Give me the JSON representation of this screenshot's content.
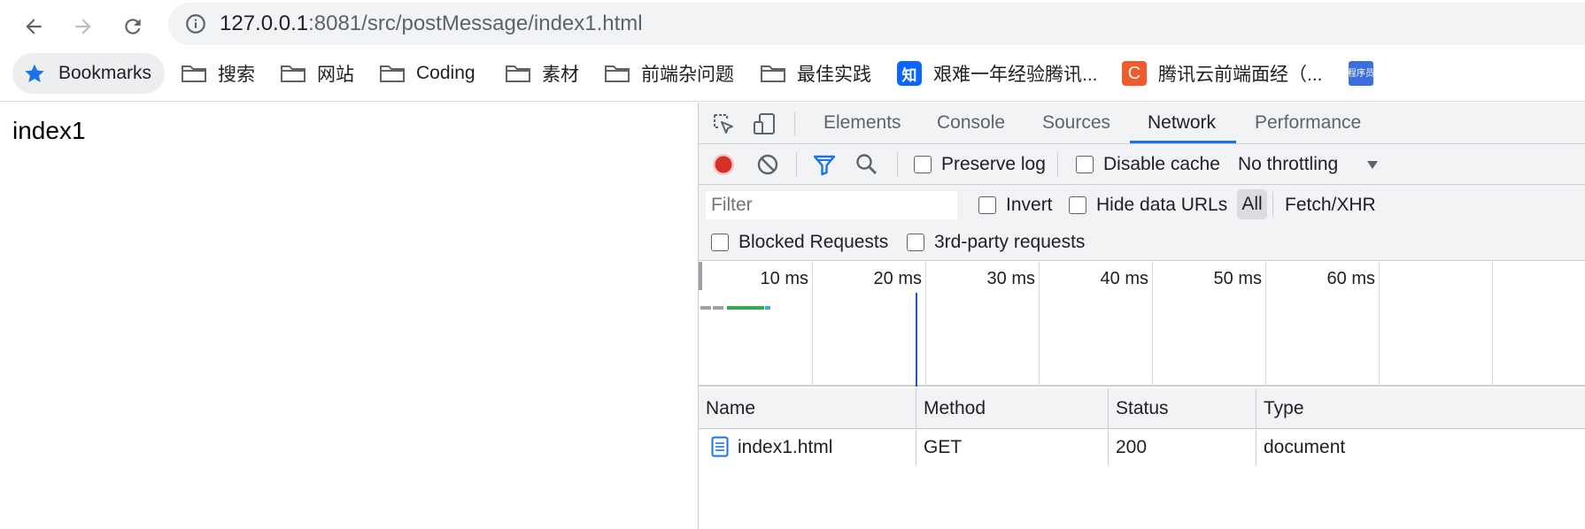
{
  "address_bar": {
    "url_host": "127.0.0.1",
    "url_rest": ":8081/src/postMessage/index1.html"
  },
  "bookmarks": [
    {
      "label": "Bookmarks",
      "icon": "star-icon"
    },
    {
      "label": "搜索",
      "icon": "folder-icon"
    },
    {
      "label": "网站",
      "icon": "folder-icon"
    },
    {
      "label": "Coding",
      "icon": "folder-icon"
    },
    {
      "label": "素材",
      "icon": "folder-icon"
    },
    {
      "label": "前端杂问题",
      "icon": "folder-icon"
    },
    {
      "label": "最佳实践",
      "icon": "folder-icon"
    },
    {
      "label": "艰难一年经验腾讯...",
      "icon": "zhihu-favicon",
      "favicon_text": "知"
    },
    {
      "label": "腾讯云前端面经（...",
      "icon": "csdn-favicon",
      "favicon_text": "C"
    },
    {
      "label": "",
      "icon": "chengxuyuan-favicon",
      "favicon_text": "程序员"
    }
  ],
  "page": {
    "text": "index1"
  },
  "devtools": {
    "tabs": [
      "Elements",
      "Console",
      "Sources",
      "Network",
      "Performance"
    ],
    "active_tab": "Network",
    "network_toolbar": {
      "preserve_log": "Preserve log",
      "disable_cache": "Disable cache",
      "throttling": "No throttling"
    },
    "filter": {
      "placeholder": "Filter",
      "invert": "Invert",
      "hide_data_urls": "Hide data URLs",
      "all": "All",
      "fetch_xhr": "Fetch/XHR",
      "blocked_requests": "Blocked Requests",
      "third_party": "3rd-party requests"
    },
    "overview_ticks": [
      "10 ms",
      "20 ms",
      "30 ms",
      "40 ms",
      "50 ms",
      "60 ms"
    ],
    "table": {
      "columns": [
        "Name",
        "Method",
        "Status",
        "Type"
      ],
      "rows": [
        {
          "name": "index1.html",
          "method": "GET",
          "status": "200",
          "type": "document"
        }
      ]
    }
  },
  "colors": {
    "accent": "#1a73e8",
    "record": "#d93025",
    "toolbar_bg": "#f1f3f4"
  }
}
